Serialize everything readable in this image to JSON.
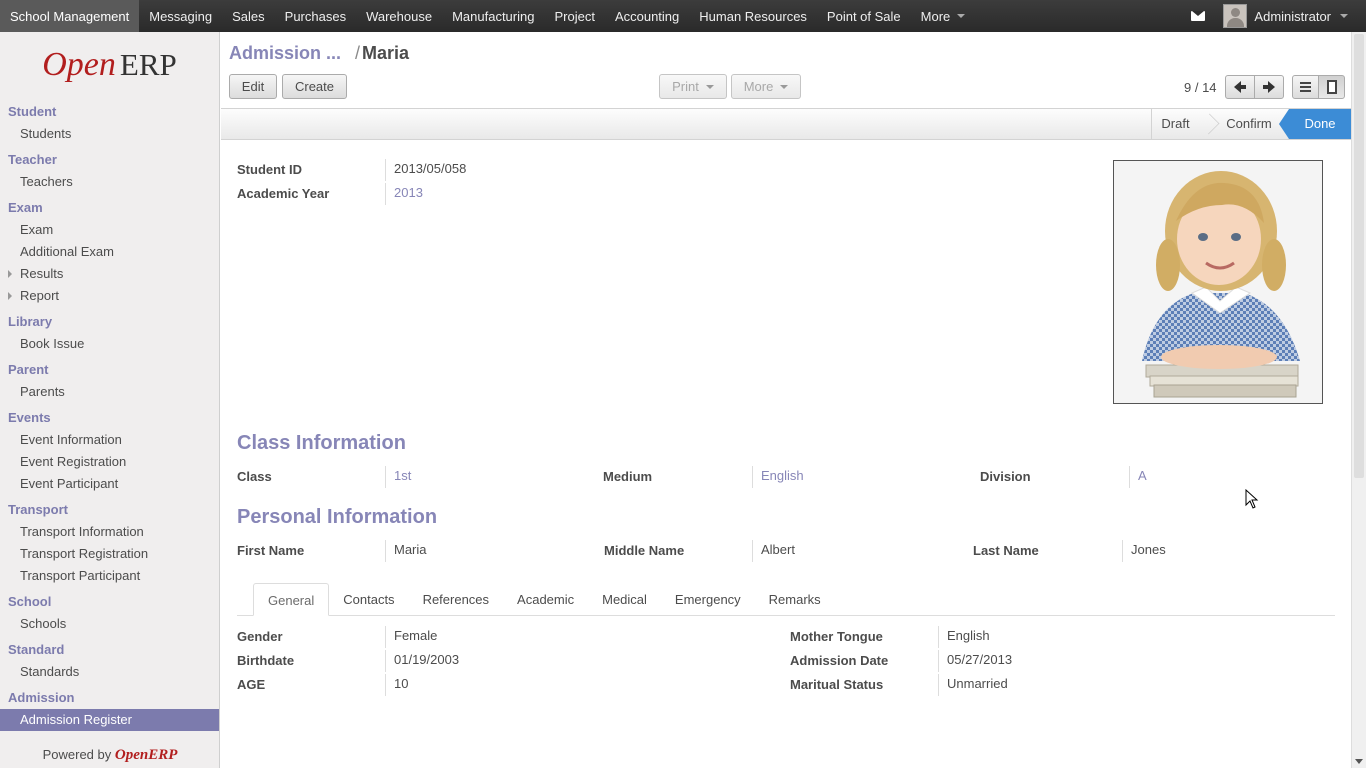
{
  "topnav": {
    "items": [
      "School Management",
      "Messaging",
      "Sales",
      "Purchases",
      "Warehouse",
      "Manufacturing",
      "Project",
      "Accounting",
      "Human Resources",
      "Point of Sale"
    ],
    "more": "More",
    "user": "Administrator"
  },
  "sidebar": {
    "logo_open": "Open",
    "logo_erp": "ERP",
    "sections": [
      {
        "title": "Student",
        "items": [
          {
            "label": "Students"
          }
        ]
      },
      {
        "title": "Teacher",
        "items": [
          {
            "label": "Teachers"
          }
        ]
      },
      {
        "title": "Exam",
        "items": [
          {
            "label": "Exam"
          },
          {
            "label": "Additional Exam"
          },
          {
            "label": "Results"
          },
          {
            "label": "Report"
          }
        ]
      },
      {
        "title": "Library",
        "items": [
          {
            "label": "Book Issue"
          }
        ]
      },
      {
        "title": "Parent",
        "items": [
          {
            "label": "Parents"
          }
        ]
      },
      {
        "title": "Events",
        "items": [
          {
            "label": "Event Information"
          },
          {
            "label": "Event Registration"
          },
          {
            "label": "Event Participant"
          }
        ]
      },
      {
        "title": "Transport",
        "items": [
          {
            "label": "Transport Information"
          },
          {
            "label": "Transport Registration"
          },
          {
            "label": "Transport Participant"
          }
        ]
      },
      {
        "title": "School",
        "items": [
          {
            "label": "Schools"
          }
        ]
      },
      {
        "title": "Standard",
        "items": [
          {
            "label": "Standards"
          }
        ]
      },
      {
        "title": "Admission",
        "items": [
          {
            "label": "Admission Register"
          }
        ]
      }
    ],
    "powered_prefix": "Powered by",
    "powered_brand": "OpenERP"
  },
  "breadcrumb": {
    "parent": "Admission ...",
    "sep": "/",
    "current": "Maria"
  },
  "toolbar": {
    "edit": "Edit",
    "create": "Create",
    "print": "Print",
    "more": "More",
    "pager": "9 / 14"
  },
  "status": {
    "stages": [
      "Draft",
      "Confirm",
      "Done"
    ],
    "active": "Done",
    "active_color": "#3c8cd6"
  },
  "record": {
    "student_id_label": "Student ID",
    "student_id": "2013/05/058",
    "academic_year_label": "Academic Year",
    "academic_year": "2013",
    "class_info_title": "Class Information",
    "class_label": "Class",
    "class": "1st",
    "medium_label": "Medium",
    "medium": "English",
    "division_label": "Division",
    "division": "A",
    "personal_info_title": "Personal Information",
    "first_name_label": "First Name",
    "first_name": "Maria",
    "middle_name_label": "Middle Name",
    "middle_name": "Albert",
    "last_name_label": "Last Name",
    "last_name": "Jones"
  },
  "tabs": [
    "General",
    "Contacts",
    "References",
    "Academic",
    "Medical",
    "Emergency",
    "Remarks"
  ],
  "active_tab": "General",
  "general": {
    "gender_label": "Gender",
    "gender": "Female",
    "birthdate_label": "Birthdate",
    "birthdate": "01/19/2003",
    "age_label": "AGE",
    "age": "10",
    "mother_tongue_label": "Mother Tongue",
    "mother_tongue": "English",
    "admission_date_label": "Admission Date",
    "admission_date": "05/27/2013",
    "marital_status_label": "Maritual Status",
    "marital_status": "Unmarried"
  }
}
